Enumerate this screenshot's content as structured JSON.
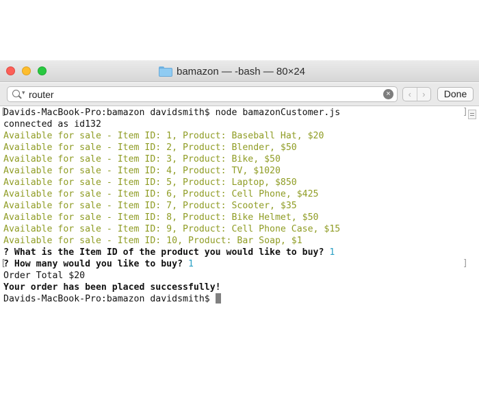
{
  "window": {
    "title": "bamazon — -bash — 80×24"
  },
  "search": {
    "value": "router",
    "done_label": "Done",
    "prev_label": "‹",
    "next_label": "›",
    "clear_label": "×"
  },
  "terminal": {
    "prompt_command": "Davids-MacBook-Pro:bamazon davidsmith$ node bamazonCustomer.js",
    "connected": "connected as id132",
    "items": [
      "Available for sale - Item ID: 1, Product: Baseball Hat, $20",
      "Available for sale - Item ID: 2, Product: Blender, $50",
      "Available for sale - Item ID: 3, Product: Bike, $50",
      "Available for sale - Item ID: 4, Product: TV, $1020",
      "Available for sale - Item ID: 5, Product: Laptop, $850",
      "Available for sale - Item ID: 6, Product: Cell Phone, $425",
      "Available for sale - Item ID: 7, Product: Scooter, $35",
      "Available for sale - Item ID: 8, Product: Bike Helmet, $50",
      "Available for sale - Item ID: 9, Product: Cell Phone Case, $15",
      "Available for sale - Item ID: 10, Product: Bar Soap, $1"
    ],
    "question1": "? What is the Item ID of the product you would like to buy?",
    "answer1": "1",
    "question2": "? How many would you like to buy?",
    "answer2": "1",
    "order_total": "Order Total $20",
    "success": "Your order has been placed successfully!",
    "final_prompt": "Davids-MacBook-Pro:bamazon davidsmith$"
  },
  "colors": {
    "item_text": "#8f9c24",
    "answer_text": "#2aa0c4"
  }
}
